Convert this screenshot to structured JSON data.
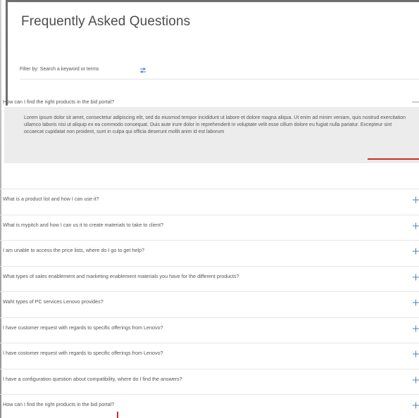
{
  "page": {
    "title": "Frequently Asked Questions"
  },
  "filter": {
    "label": "Filter by: Search a keyword or terms",
    "icon": "filter-sliders-icon"
  },
  "expanded": {
    "question": "How can I find the right products in the bid portal?",
    "answer": "Lorem ipsum dolor sit amet, consectetur adipiscing elit, sed do eiusmod tempor incididunt ut labore et dolore magna aliqua. Ut enim ad minim veniam, quis nostrud exercitation ullamco laboris nisi ut aliquip ex ea commodo consequat. Duis aute irure dolor in reprehenderit in voluptate velit esse cillum dolore eu fugiat nulla pariatur. Excepteur sint occaecat cupidatat non proident, sunt in culpa qui officia deserunt mollit anim id est laborum",
    "icon": "minus-icon"
  },
  "questions": [
    {
      "text": "What is a product list and how I can use it?",
      "icon": "plus-icon"
    },
    {
      "text": "What is mypitch and how I can us it to create materials to take to client?",
      "icon": "plus-icon"
    },
    {
      "text": "I am unable to access the price lists, where do I go to get help?",
      "icon": "plus-icon"
    },
    {
      "text": "What types of sales enablement and marketing enablement materials you have for the different products?",
      "icon": "plus-icon"
    },
    {
      "text": "Waht types of PC services Lenovo provides?",
      "icon": "plus-icon"
    },
    {
      "text": "I have customer request with regards to specific offerings from Lenovo?",
      "icon": "plus-icon"
    },
    {
      "text": "I have costomer request with regards to specific offerings from Lenovo?",
      "icon": "plus-icon"
    },
    {
      "text": "I have a configuration question about compatibility, where do I find the answers?",
      "icon": "plus-icon"
    },
    {
      "text": "How can I find the right products in the bid portal?",
      "icon": "plus-icon"
    }
  ],
  "colors": {
    "accent_plus": "#4a7fc1",
    "answer_bg": "#ececec",
    "marker_red": "#d22a26",
    "text": "#555555"
  }
}
